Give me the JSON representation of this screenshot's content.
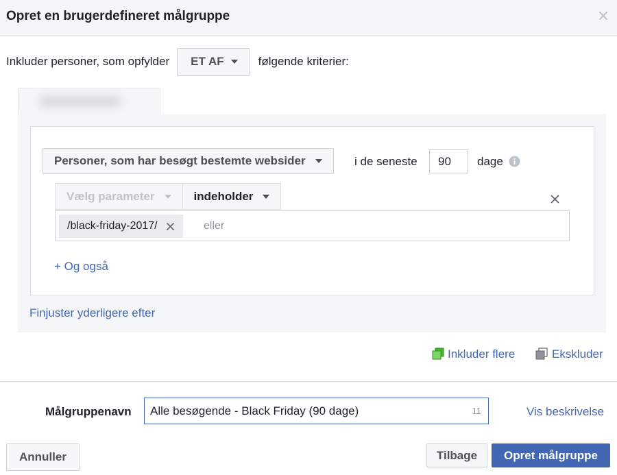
{
  "dialog": {
    "title": "Opret en brugerdefineret målgruppe"
  },
  "criteria": {
    "prefix": "Inkluder personer, som opfylder",
    "match_mode": "ET AF",
    "suffix": "følgende kriterier:"
  },
  "rule": {
    "source": "Personer, som har besøgt bestemte websider",
    "in_last_label": "i de seneste",
    "days_value": "90",
    "days_label": "dage",
    "parameter_placeholder": "Vælg parameter",
    "operator": "indeholder",
    "tag_value": "/black-friday-2017/",
    "or_placeholder": "eller",
    "and_also_link": "+ Og også"
  },
  "refine_link": "Finjuster yderligere efter",
  "actions": {
    "include_more": "Inkluder flere",
    "exclude": "Ekskluder"
  },
  "audience_name": {
    "label": "Målgruppenavn",
    "value": "Alle besøgende - Black Friday (90 dage)",
    "counter": "11",
    "show_description": "Vis beskrivelse"
  },
  "footer": {
    "cancel": "Annuller",
    "back": "Tilbage",
    "create": "Opret målgruppe"
  },
  "colors": {
    "link": "#365899",
    "primary_button": "#4267b2",
    "icon_green": "#42b72a"
  }
}
